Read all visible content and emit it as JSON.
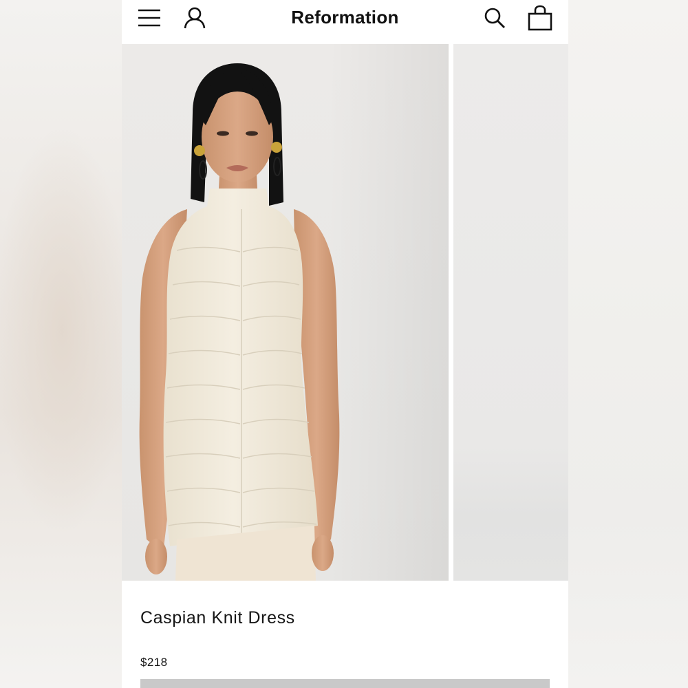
{
  "header": {
    "brand": "Reformation",
    "icons": [
      "menu-icon",
      "account-icon",
      "search-icon",
      "bag-icon"
    ]
  },
  "product": {
    "name": "Caspian Knit Dress",
    "price": "$218"
  },
  "colors": {
    "background": "#ffffff",
    "text": "#151515",
    "dress": "#f1ebdd",
    "photo_background": "#eae9e7",
    "cta": "#c9c9c9"
  }
}
